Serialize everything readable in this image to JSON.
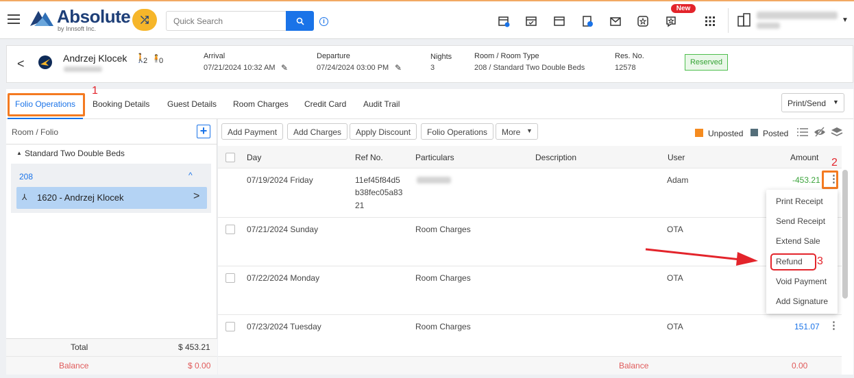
{
  "topbar": {
    "logo": "Absolute",
    "logo_sub": "by Innsoft Inc.",
    "search_placeholder": "Quick Search",
    "new_badge": "New"
  },
  "reservation": {
    "guest_name": "Andrzej Klocek",
    "adults": "2",
    "children": "0",
    "arrival_label": "Arrival",
    "arrival_value": "07/21/2024 10:32 AM",
    "departure_label": "Departure",
    "departure_value": "07/24/2024 03:00 PM",
    "nights_label": "Nights",
    "nights_value": "3",
    "room_label": "Room / Room Type",
    "room_value": "208 / Standard Two Double Beds",
    "resno_label": "Res. No.",
    "resno_value": "12578",
    "status": "Reserved"
  },
  "tabs": [
    "Folio Operations",
    "Booking Details",
    "Guest Details",
    "Room Charges",
    "Credit Card",
    "Audit Trail"
  ],
  "print_send": "Print/Send",
  "annotations": {
    "one": "1",
    "two": "2",
    "three": "3"
  },
  "left_panel": {
    "header": "Room / Folio",
    "room_type": "Standard Two Double Beds",
    "room_number": "208",
    "folio": "1620 - Andrzej Klocek",
    "total_label": "Total",
    "total_value": "$ 453.21",
    "balance_label": "Balance",
    "balance_value": "$ 0.00"
  },
  "actions": [
    "Add Payment",
    "Add Charges",
    "Apply Discount",
    "Folio Operations",
    "More"
  ],
  "legend": {
    "unposted": "Unposted",
    "posted": "Posted",
    "unposted_color": "#f58b1f",
    "posted_color": "#546e7a"
  },
  "table": {
    "headers": {
      "day": "Day",
      "ref": "Ref No.",
      "particulars": "Particulars",
      "description": "Description",
      "user": "User",
      "amount": "Amount"
    },
    "rows": [
      {
        "day": "07/19/2024 Friday",
        "ref": [
          "11ef45f84d5",
          "b38fec05a83",
          "21"
        ],
        "particulars": "",
        "user": "Adam",
        "amount": "-453.21"
      },
      {
        "day": "07/21/2024 Sunday",
        "ref": [],
        "particulars": "Room Charges",
        "user": "OTA",
        "amount": ""
      },
      {
        "day": "07/22/2024 Monday",
        "ref": [],
        "particulars": "Room Charges",
        "user": "OTA",
        "amount": ""
      },
      {
        "day": "07/23/2024 Tuesday",
        "ref": [],
        "particulars": "Room Charges",
        "user": "OTA",
        "amount": "151.07"
      }
    ],
    "balance_label": "Balance",
    "balance_value": "0.00"
  },
  "context_menu": [
    "Print Receipt",
    "Send Receipt",
    "Extend Sale",
    "Refund",
    "Void Payment",
    "Add Signature"
  ]
}
